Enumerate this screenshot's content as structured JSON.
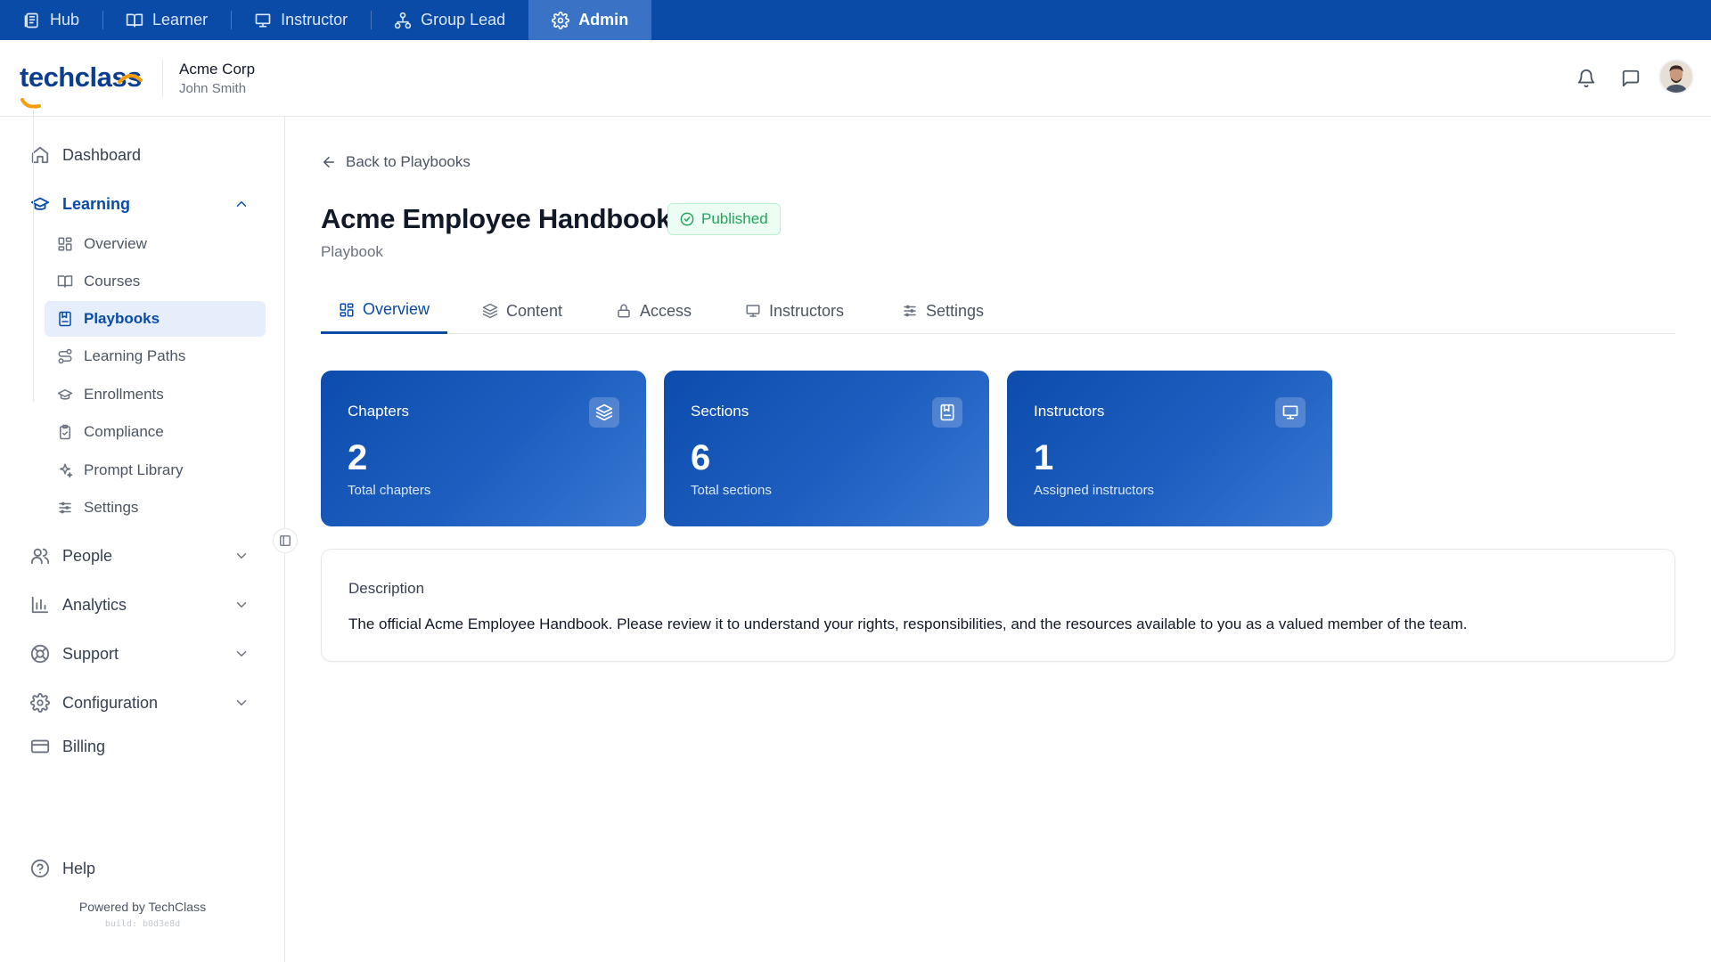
{
  "role_bar": {
    "items": [
      {
        "label": "Hub",
        "icon": "hub-icon"
      },
      {
        "label": "Learner",
        "icon": "book-open-icon"
      },
      {
        "label": "Instructor",
        "icon": "presentation-icon"
      },
      {
        "label": "Group Lead",
        "icon": "org-chart-icon"
      },
      {
        "label": "Admin",
        "icon": "gear-icon",
        "active": true
      }
    ]
  },
  "header": {
    "logo_text": "techclass",
    "org_name": "Acme Corp",
    "user_name": "John Smith",
    "icons": [
      "bell-icon",
      "chat-icon"
    ]
  },
  "sidebar": {
    "dashboard": "Dashboard",
    "learning": "Learning",
    "learning_items": [
      {
        "label": "Overview",
        "icon": "grid-icon"
      },
      {
        "label": "Courses",
        "icon": "book-open-icon"
      },
      {
        "label": "Playbooks",
        "icon": "playbook-icon",
        "active": true
      },
      {
        "label": "Learning Paths",
        "icon": "route-icon"
      },
      {
        "label": "Enrollments",
        "icon": "graduation-cap-icon"
      },
      {
        "label": "Compliance",
        "icon": "clipboard-check-icon"
      },
      {
        "label": "Prompt Library",
        "icon": "sparkles-icon"
      },
      {
        "label": "Settings",
        "icon": "sliders-icon"
      }
    ],
    "people": "People",
    "analytics": "Analytics",
    "support": "Support",
    "configuration": "Configuration",
    "billing": "Billing",
    "help": "Help",
    "powered_by": "Powered by TechClass",
    "build": "build: b0d3e8d"
  },
  "main": {
    "back_label": "Back to Playbooks",
    "title": "Acme Employee Handbook",
    "status": "Published",
    "subtitle": "Playbook",
    "tabs": [
      {
        "label": "Overview",
        "icon": "grid-icon",
        "active": true
      },
      {
        "label": "Content",
        "icon": "layers-icon"
      },
      {
        "label": "Access",
        "icon": "lock-icon"
      },
      {
        "label": "Instructors",
        "icon": "presentation-icon"
      },
      {
        "label": "Settings",
        "icon": "sliders-icon"
      }
    ],
    "stats": [
      {
        "label": "Chapters",
        "value": "2",
        "desc": "Total chapters",
        "icon": "layers-icon"
      },
      {
        "label": "Sections",
        "value": "6",
        "desc": "Total sections",
        "icon": "playbook-icon"
      },
      {
        "label": "Instructors",
        "value": "1",
        "desc": "Assigned instructors",
        "icon": "presentation-icon"
      }
    ],
    "description_title": "Description",
    "description_text": "The official Acme Employee Handbook. Please review it to understand your rights, responsibilities, and the resources available to you as a valued member of the team."
  },
  "colors": {
    "brand_blue": "#0a4ba8",
    "published_green": "#22a45d",
    "logo_orange": "#f59e0b"
  }
}
